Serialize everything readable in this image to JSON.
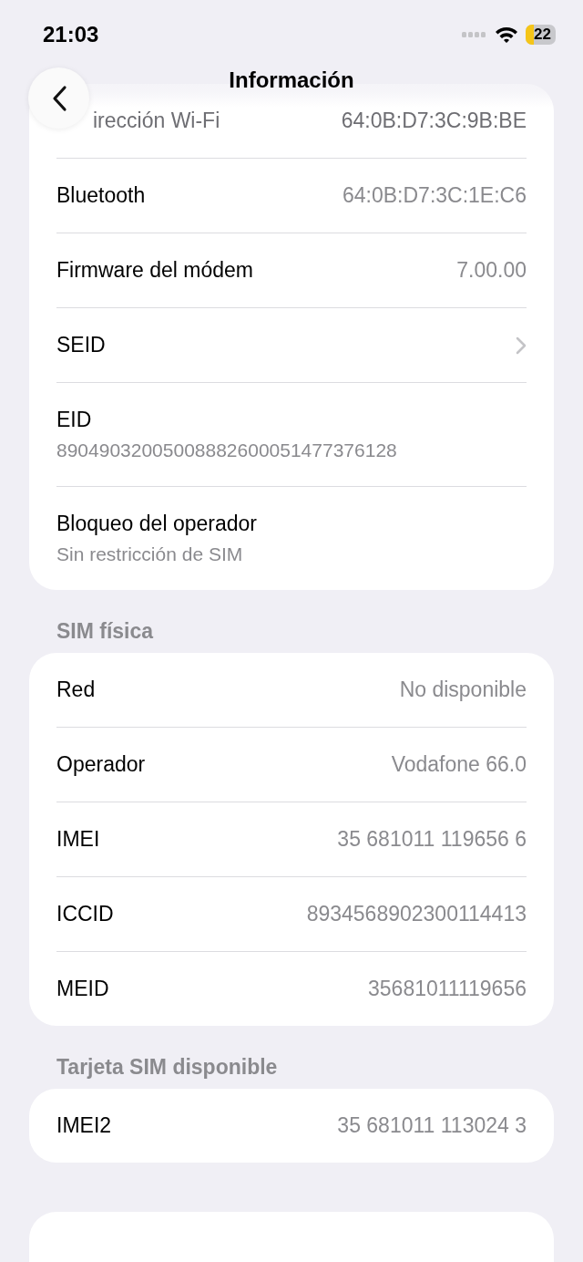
{
  "status_bar": {
    "time": "21:03",
    "battery": "22"
  },
  "header": {
    "title": "Información"
  },
  "sections": [
    {
      "rows": [
        {
          "kind": "value",
          "label": "irección Wi-Fi",
          "value": "64:0B:D7:3C:9B:BE"
        },
        {
          "kind": "value",
          "label": "Bluetooth",
          "value": "64:0B:D7:3C:1E:C6"
        },
        {
          "kind": "value",
          "label": "Firmware del módem",
          "value": "7.00.00"
        },
        {
          "kind": "link",
          "label": "SEID"
        },
        {
          "kind": "stacked",
          "label": "EID",
          "value": "89049032005008882600051477376128"
        },
        {
          "kind": "stacked",
          "label": "Bloqueo del operador",
          "value": "Sin restricción de SIM"
        }
      ]
    },
    {
      "title": "SIM física",
      "rows": [
        {
          "kind": "value",
          "label": "Red",
          "value": "No disponible"
        },
        {
          "kind": "value",
          "label": "Operador",
          "value": "Vodafone 66.0"
        },
        {
          "kind": "value",
          "label": "IMEI",
          "value": "35 681011 119656 6"
        },
        {
          "kind": "value",
          "label": "ICCID",
          "value": "8934568902300114413"
        },
        {
          "kind": "value",
          "label": "MEID",
          "value": "35681011119656"
        }
      ]
    },
    {
      "title": "Tarjeta SIM disponible",
      "rows": [
        {
          "kind": "value",
          "label": "IMEI2",
          "value": "35 681011 113024 3"
        }
      ]
    }
  ]
}
